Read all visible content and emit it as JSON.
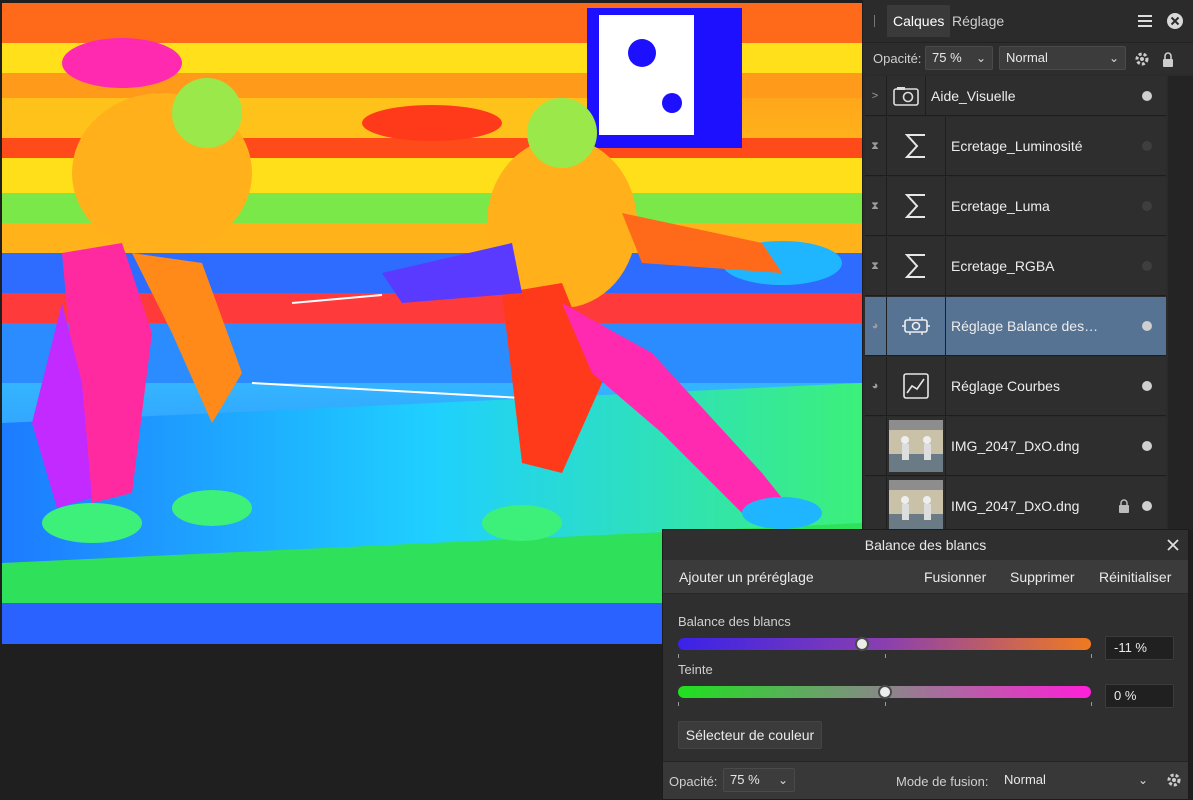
{
  "panel": {
    "tabs": [
      {
        "label": "Calques",
        "active": true
      },
      {
        "label": "Réglage",
        "active": false
      }
    ],
    "opacity_label": "Opacité:",
    "opacity_value": "75 %",
    "blend_mode": "Normal",
    "layers": [
      {
        "name": "Aide_Visuelle",
        "icon": "camera-group-icon",
        "left_icon": "chevron-right-icon",
        "left_glyph": ">",
        "visible": true,
        "selected": false,
        "locked": false
      },
      {
        "name": "Ecretage_Luminosité",
        "icon": "sigma-icon",
        "left_icon": "hourglass-icon",
        "left_glyph": "⧗",
        "visible": false,
        "selected": false,
        "locked": false
      },
      {
        "name": "Ecretage_Luma",
        "icon": "sigma-icon",
        "left_icon": "hourglass-icon",
        "left_glyph": "⧗",
        "visible": false,
        "selected": false,
        "locked": false
      },
      {
        "name": "Ecretage_RGBA",
        "icon": "sigma-icon",
        "left_icon": "hourglass-icon",
        "left_glyph": "⧗",
        "visible": false,
        "selected": false,
        "locked": false
      },
      {
        "name": "Réglage Balance des…",
        "icon": "white-balance-icon",
        "left_icon": "half-circle-icon",
        "left_glyph": "◕",
        "visible": true,
        "selected": true,
        "locked": false
      },
      {
        "name": "Réglage Courbes",
        "icon": "curves-icon",
        "left_icon": "half-circle-icon",
        "left_glyph": "◕",
        "visible": true,
        "selected": false,
        "locked": false
      },
      {
        "name": "IMG_2047_DxO.dng",
        "icon": "image-thumbnail",
        "left_icon": "",
        "left_glyph": "",
        "visible": true,
        "selected": false,
        "locked": false
      },
      {
        "name": "IMG_2047_DxO.dng",
        "icon": "image-thumbnail",
        "left_icon": "",
        "left_glyph": "",
        "visible": true,
        "selected": false,
        "locked": true
      }
    ]
  },
  "dialog": {
    "title": "Balance des blancs",
    "add_preset": "Ajouter un préréglage",
    "merge": "Fusionner",
    "delete": "Supprimer",
    "reset": "Réinitialiser",
    "white_balance_label": "Balance des blancs",
    "white_balance_value": "-11 %",
    "white_balance_level": -0.11,
    "tint_label": "Teinte",
    "tint_value": "0 %",
    "tint_level": 0,
    "color_picker": "Sélecteur de couleur",
    "opacity_label": "Opacité:",
    "opacity_value": "75 %",
    "blend_label": "Mode de fusion:",
    "blend_value": "Normal"
  },
  "colors": {
    "selected_layer": "#577394",
    "wb_gradient": [
      "#3a22e8",
      "#8a3fb0",
      "#f07a20"
    ],
    "tint_gradient": [
      "#1fe01f",
      "#888888",
      "#ff1fd8"
    ]
  }
}
